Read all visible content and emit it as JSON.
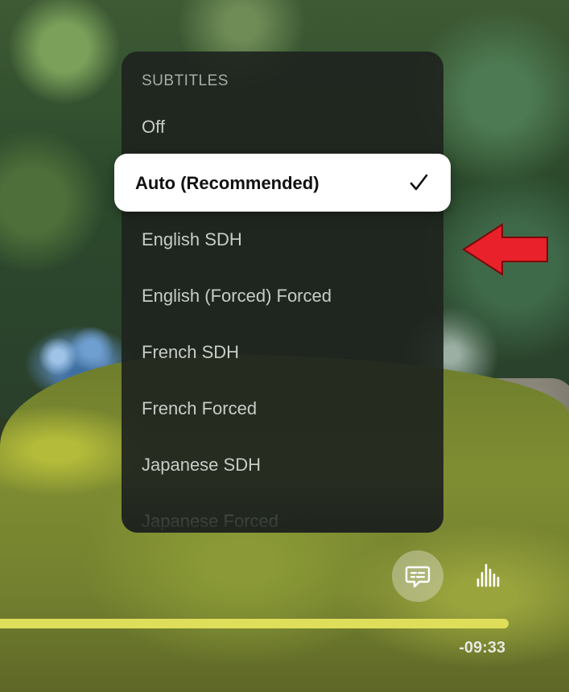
{
  "menu": {
    "header": "SUBTITLES",
    "items": [
      {
        "label": "Off"
      },
      {
        "label": "Auto (Recommended)",
        "selected": true
      },
      {
        "label": "English SDH"
      },
      {
        "label": "English (Forced) Forced"
      },
      {
        "label": "French SDH"
      },
      {
        "label": "French Forced"
      },
      {
        "label": "Japanese SDH"
      },
      {
        "label": "Japanese Forced"
      }
    ]
  },
  "player": {
    "time_remaining": "-09:33",
    "progress": 1.0,
    "subtitle_icon": "subtitle-bubble-icon",
    "audio_icon": "audio-bars-icon"
  },
  "annotation": {
    "arrow_color": "#e8212a"
  },
  "colors": {
    "progress": "#dede5a",
    "selection": "#ffffff"
  }
}
